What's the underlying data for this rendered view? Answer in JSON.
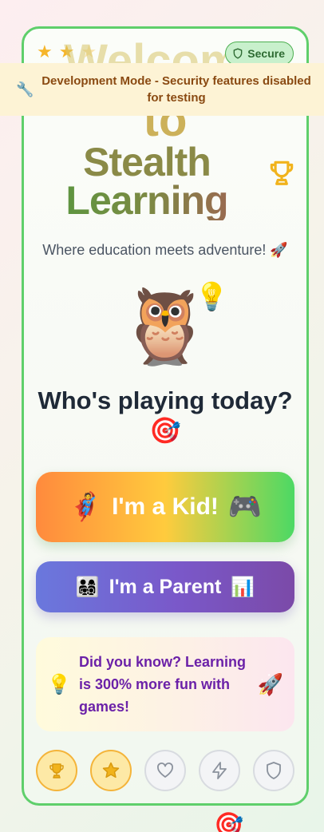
{
  "header": {
    "welcome_ghost": "Welcome",
    "to_ghost": "to",
    "secure_label": "Secure"
  },
  "dev_banner": {
    "icon": "wrench-icon",
    "message": "Development Mode - Security features disabled for testing"
  },
  "title": {
    "line1": "Stealth",
    "line2": "Learning"
  },
  "tagline": "Where education meets adventure! 🚀",
  "mascot": {
    "owl": "🦉",
    "bulb": "💡"
  },
  "question": {
    "text": "Who's playing today?",
    "emoji": "🎯"
  },
  "kid_button": {
    "left_emoji": "🦸",
    "label": "I'm a Kid!",
    "right_emoji": "🎮"
  },
  "parent_button": {
    "left_emoji": "👨‍👩‍👧‍👦",
    "label": "I'm a Parent",
    "right_emoji": "📊"
  },
  "fact": {
    "icon": "💡",
    "text": "Did you know? Learning is 300% more fun with games!",
    "end_emoji": "🚀"
  },
  "icon_bar": [
    {
      "name": "trophy-icon",
      "active": true
    },
    {
      "name": "star-icon",
      "active": true
    },
    {
      "name": "heart-icon",
      "active": false
    },
    {
      "name": "zap-icon",
      "active": false
    },
    {
      "name": "shield-icon",
      "active": false
    }
  ],
  "stars_rating": {
    "filled": 2,
    "total": 3
  },
  "colors": {
    "card_border": "#5fcf6b",
    "banner_bg": "#fdf3d5",
    "banner_text": "#8a4a12",
    "fact_text": "#6b21a8",
    "active_icon_bg": "#fde9a6"
  }
}
